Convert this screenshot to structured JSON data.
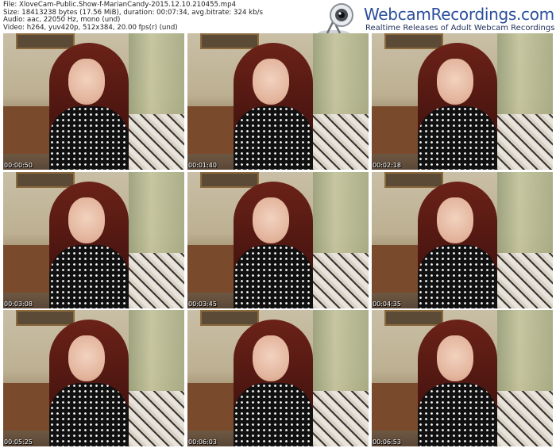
{
  "header": {
    "meta_lines": [
      "File: XloveCam-Public.Show-f-MarianCandy-2015.12.10.210455.mp4",
      "Size: 18413238 bytes (17.56 MiB), duration: 00:07:34, avg.bitrate: 324 kb/s",
      "Audio: aac, 22050 Hz, mono (und)",
      "Video: h264, yuv420p, 512x384, 20.00 fps(r) (und)"
    ]
  },
  "logo": {
    "brand": "WebcamRecordings.com",
    "tagline": "Realtime Releases of Adult Webcam Recordings",
    "icon": "webcam-icon",
    "brand_color": "#2a4f9c"
  },
  "thumbnails": [
    {
      "timestamp": "00:00:50"
    },
    {
      "timestamp": "00:01:40"
    },
    {
      "timestamp": "00:02:18"
    },
    {
      "timestamp": "00:03:08"
    },
    {
      "timestamp": "00:03:45"
    },
    {
      "timestamp": "00:04:35"
    },
    {
      "timestamp": "00:05:25"
    },
    {
      "timestamp": "00:06:03"
    },
    {
      "timestamp": "00:06:53"
    }
  ]
}
